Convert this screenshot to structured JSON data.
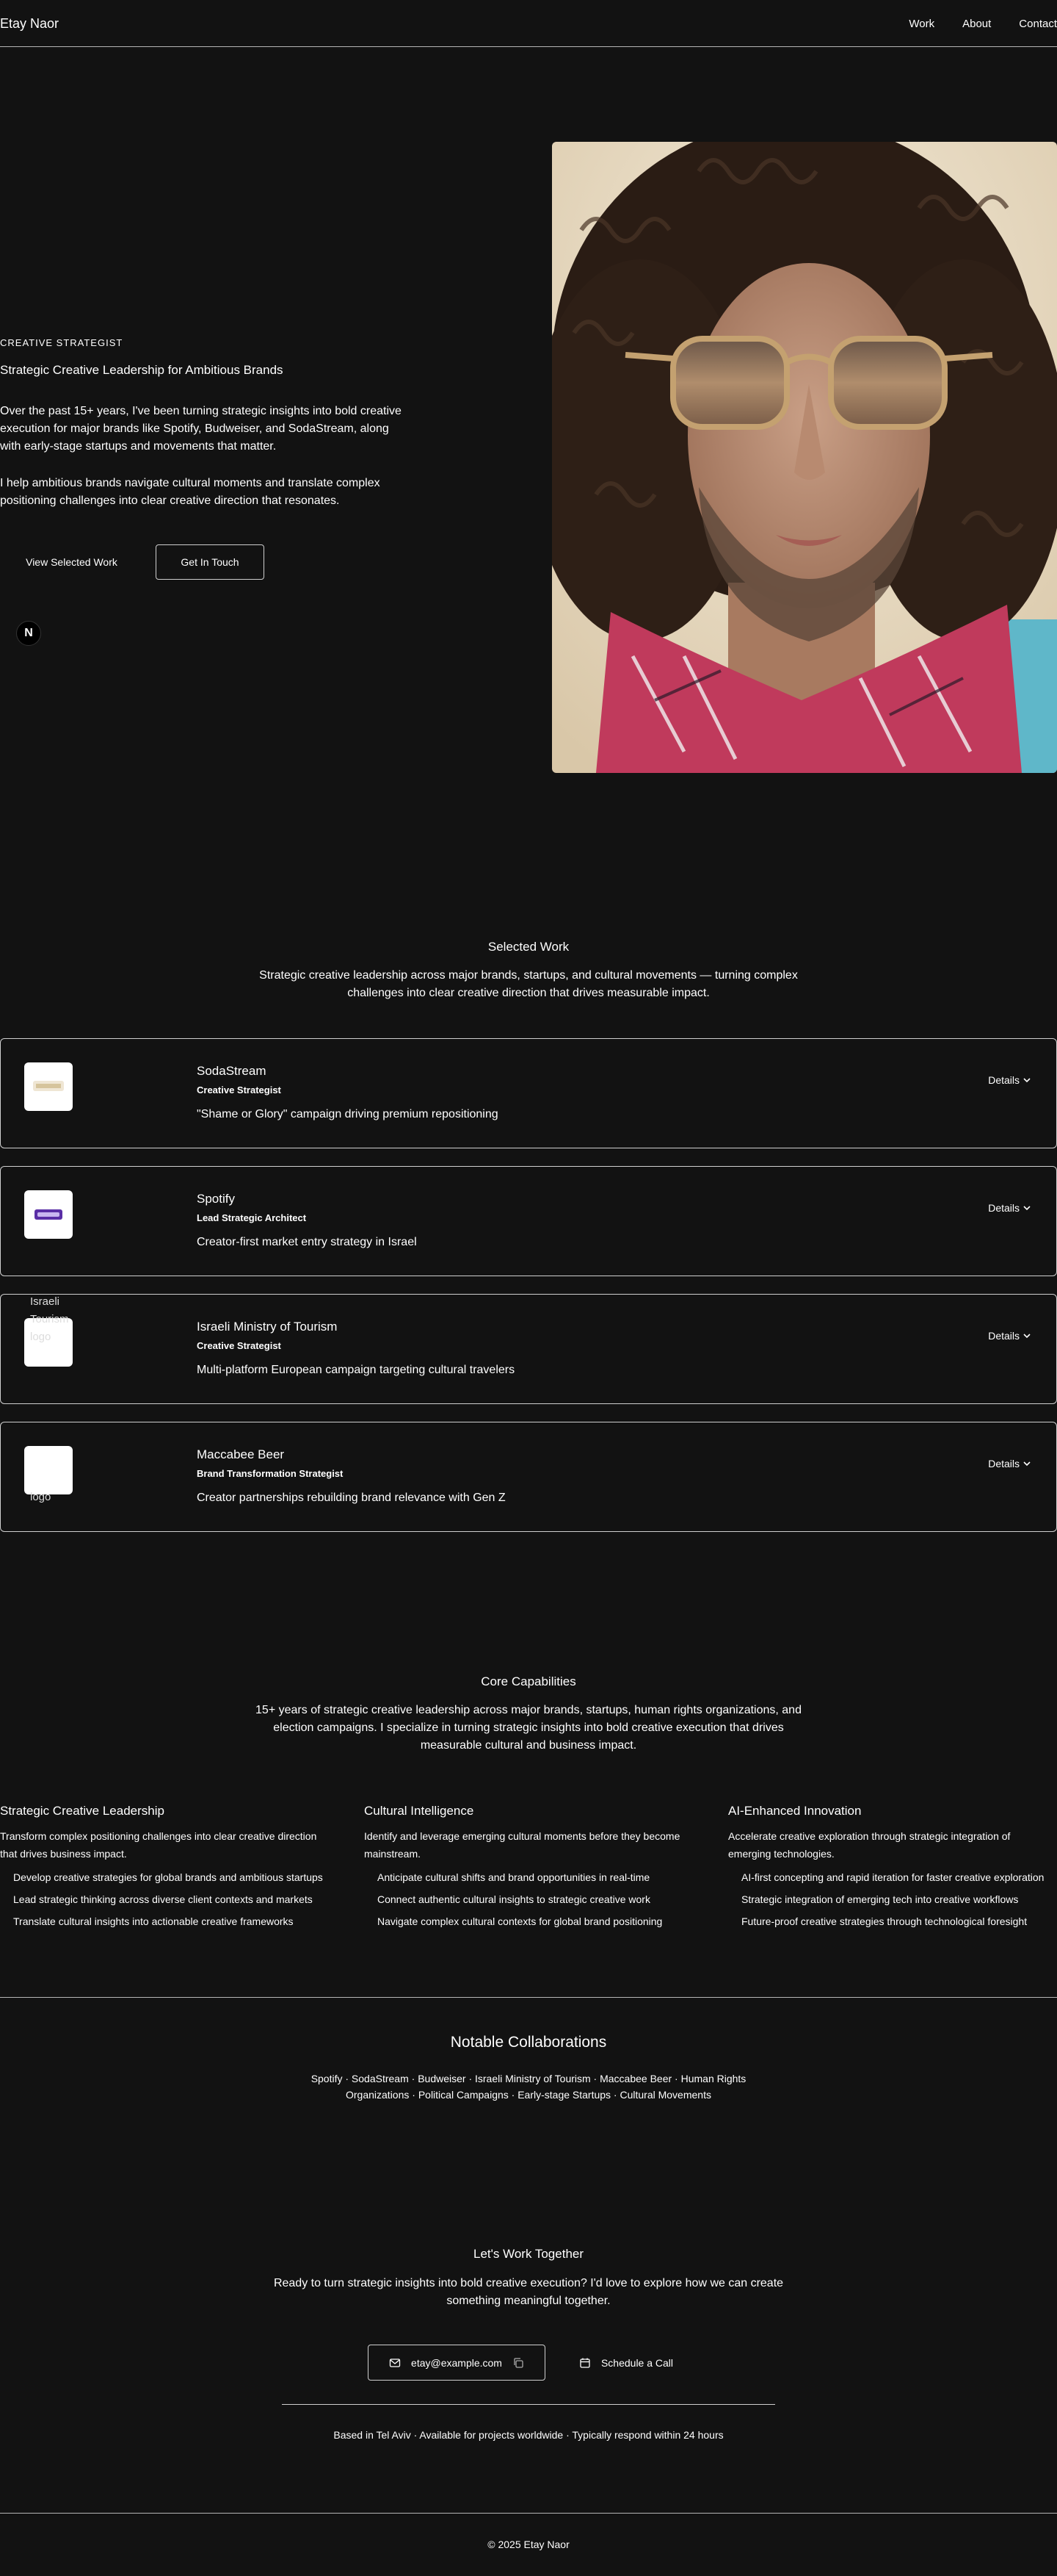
{
  "header": {
    "logo": "Etay Naor",
    "nav": [
      "Work",
      "About",
      "Contact"
    ]
  },
  "hero": {
    "eyebrow": "CREATIVE STRATEGIST",
    "subtitle": "Strategic Creative Leadership for Ambitious Brands",
    "paragraph1": "Over the past 15+ years, I've been turning strategic insights into bold creative execution for major brands like Spotify, Budweiser, and SodaStream, along with early-stage startups and movements that matter.",
    "paragraph2": "I help ambitious brands navigate cultural moments and translate complex positioning challenges into clear creative direction that resonates.",
    "primary_button": "View Selected Work",
    "secondary_button": "Get In Touch",
    "badge": "N"
  },
  "work": {
    "title": "Selected Work",
    "description": "Strategic creative leadership across major brands, startups, and cultural movements — turning complex challenges into clear creative direction that drives measurable impact.",
    "details_label": "Details",
    "items": [
      {
        "title": "SodaStream",
        "role": "Creative Strategist",
        "desc": "\"Shame or Glory\" campaign driving premium repositioning",
        "logo_alt": ""
      },
      {
        "title": "Spotify",
        "role": "Lead Strategic Architect",
        "desc": "Creator-first market entry strategy in Israel",
        "logo_alt": ""
      },
      {
        "title": "Israeli Ministry of Tourism",
        "role": "Creative Strategist",
        "desc": "Multi-platform European campaign targeting cultural travelers",
        "logo_alt": "Israeli Tourism logo"
      },
      {
        "title": "Maccabee Beer",
        "role": "Brand Transformation Strategist",
        "desc": "Creator partnerships rebuilding brand relevance with Gen Z",
        "logo_alt": "logo"
      }
    ]
  },
  "capabilities": {
    "title": "Core Capabilities",
    "description": "15+ years of strategic creative leadership across major brands, startups, human rights organizations, and election campaigns. I specialize in turning strategic insights into bold creative execution that drives measurable cultural and business impact.",
    "columns": [
      {
        "title": "Strategic Creative Leadership",
        "desc": "Transform complex positioning challenges into clear creative direction that drives business impact.",
        "items": [
          "Develop creative strategies for global brands and ambitious startups",
          "Lead strategic thinking across diverse client contexts and markets",
          "Translate cultural insights into actionable creative frameworks"
        ]
      },
      {
        "title": "Cultural Intelligence",
        "desc": "Identify and leverage emerging cultural moments before they become mainstream.",
        "items": [
          "Anticipate cultural shifts and brand opportunities in real-time",
          "Connect authentic cultural insights to strategic creative work",
          "Navigate complex cultural contexts for global brand positioning"
        ]
      },
      {
        "title": "AI-Enhanced Innovation",
        "desc": "Accelerate creative exploration through strategic integration of emerging technologies.",
        "items": [
          "AI-first concepting and rapid iteration for faster creative exploration",
          "Strategic integration of emerging tech into creative workflows",
          "Future-proof creative strategies through technological foresight"
        ]
      }
    ]
  },
  "collaborations": {
    "title": "Notable Collaborations",
    "text": "Spotify · SodaStream · Budweiser · Israeli Ministry of Tourism · Maccabee Beer · Human Rights Organizations · Political Campaigns · Early-stage Startups · Cultural Movements"
  },
  "contact": {
    "title": "Let's Work Together",
    "description": "Ready to turn strategic insights into bold creative execution? I'd love to explore how we can create something meaningful together.",
    "email": "etay@example.com",
    "call_label": "Schedule a Call",
    "meta": "Based in Tel Aviv · Available for projects worldwide · Typically respond within 24 hours"
  },
  "footer": {
    "copyright": "© 2025 Etay Naor"
  },
  "icons": {
    "details": "chevron-down-icon",
    "email": "mail-icon",
    "copy": "copy-icon",
    "call": "calendar-icon"
  },
  "colors": {
    "background": "#121212",
    "text": "#ffffff",
    "border": "#cfcfcf"
  }
}
